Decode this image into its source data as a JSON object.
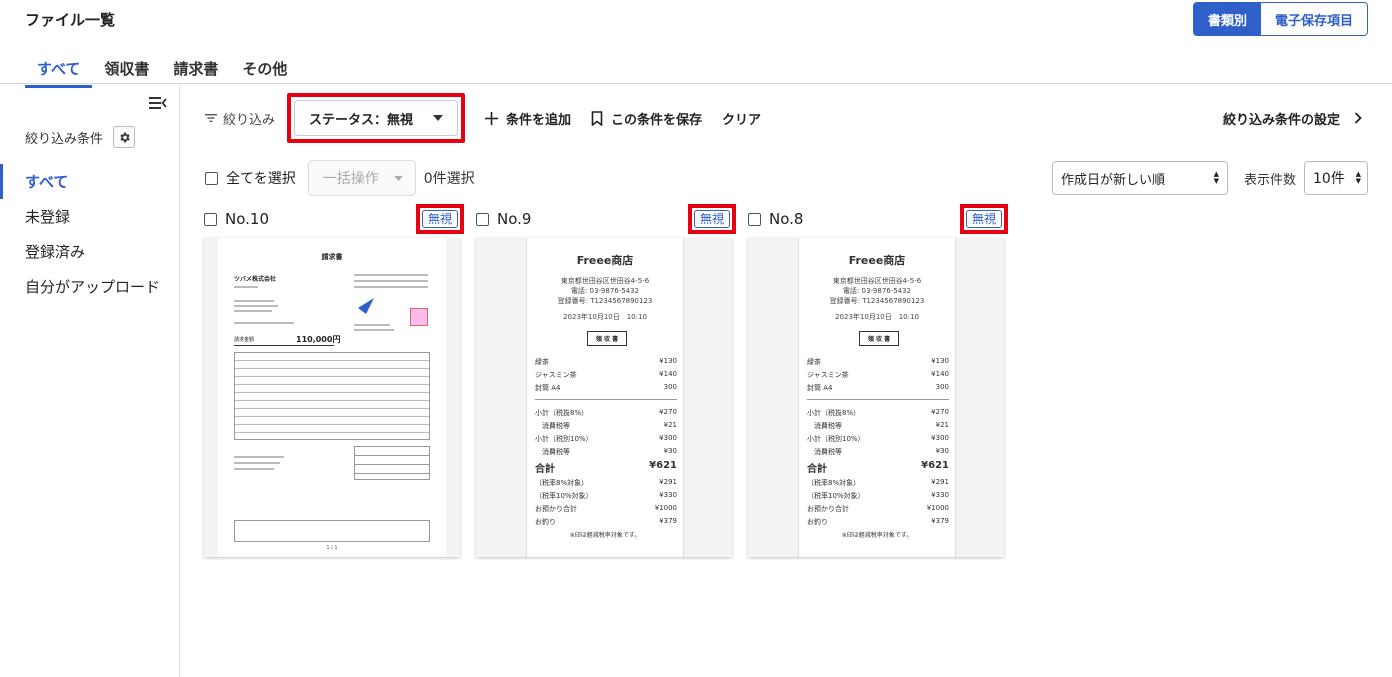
{
  "header": {
    "title": "ファイル一覧",
    "view_toggle": [
      "書類別",
      "電子保存項目"
    ]
  },
  "tabs": [
    "すべて",
    "領収書",
    "請求書",
    "その他"
  ],
  "sidebar": {
    "heading": "絞り込み条件",
    "items": [
      "すべて",
      "未登録",
      "登録済み",
      "自分がアップロード"
    ]
  },
  "filter_bar": {
    "label": "絞り込み",
    "status_select": "ステータス：無視",
    "add_condition": "条件を追加",
    "save_condition": "この条件を保存",
    "clear": "クリア",
    "settings": "絞り込み条件の設定"
  },
  "toolbar": {
    "select_all": "全てを選択",
    "bulk_action": "一括操作",
    "selected_count": "0件選択",
    "sort": "作成日が新しい順",
    "per_page_label": "表示件数",
    "per_page": "10件"
  },
  "cards": [
    {
      "no": "No.10",
      "badge": "無視",
      "invoice": {
        "title": "請求書",
        "company": "ツバメ株式会社",
        "amount_label": "請求金額",
        "amount": "110,000円",
        "page": "1 / 1"
      }
    },
    {
      "no": "No.9",
      "badge": "無視",
      "receipt": {
        "shop": "Freee商店",
        "address": "東京都世田谷区世田谷4-5-6",
        "phone": "電話: 03-9876-5432",
        "reg": "登録番号: T1234567890123",
        "datetime": "2023年10月10日　10:10",
        "doc": "領 収 書",
        "items": [
          [
            "緑茶",
            "¥130"
          ],
          [
            "ジャスミン茶",
            "¥140"
          ],
          [
            "封筒 A4",
            "300"
          ]
        ],
        "subtotals": [
          [
            "小計（税抜8%）",
            "¥270"
          ],
          [
            "　消費税等",
            "¥21"
          ],
          [
            "小計（税別10%）",
            "¥300"
          ],
          [
            "　消費税等",
            "¥30"
          ]
        ],
        "total": [
          "合計",
          "¥621"
        ],
        "details": [
          [
            "（税率8%対象）",
            "¥291"
          ],
          [
            "（税率10%対象）",
            "¥330"
          ],
          [
            "お預かり合計",
            "¥1000"
          ],
          [
            "お釣り",
            "¥379"
          ]
        ],
        "note": "※印は軽減税率対象です。"
      }
    },
    {
      "no": "No.8",
      "badge": "無視",
      "receipt": {
        "shop": "Freee商店",
        "address": "東京都世田谷区世田谷4-5-6",
        "phone": "電話: 03-9876-5432",
        "reg": "登録番号: T1234567890123",
        "datetime": "2023年10月10日　10:10",
        "doc": "領 収 書",
        "items": [
          [
            "緑茶",
            "¥130"
          ],
          [
            "ジャスミン茶",
            "¥140"
          ],
          [
            "封筒 A4",
            "300"
          ]
        ],
        "subtotals": [
          [
            "小計（税抜8%）",
            "¥270"
          ],
          [
            "　消費税等",
            "¥21"
          ],
          [
            "小計（税別10%）",
            "¥300"
          ],
          [
            "　消費税等",
            "¥30"
          ]
        ],
        "total": [
          "合計",
          "¥621"
        ],
        "details": [
          [
            "（税率8%対象）",
            "¥291"
          ],
          [
            "（税率10%対象）",
            "¥330"
          ],
          [
            "お預かり合計",
            "¥1000"
          ],
          [
            "お釣り",
            "¥379"
          ]
        ],
        "note": "※印は軽減税率対象です。"
      }
    }
  ],
  "colors": {
    "accent": "#2f5fc8",
    "highlight": "#e60012"
  }
}
